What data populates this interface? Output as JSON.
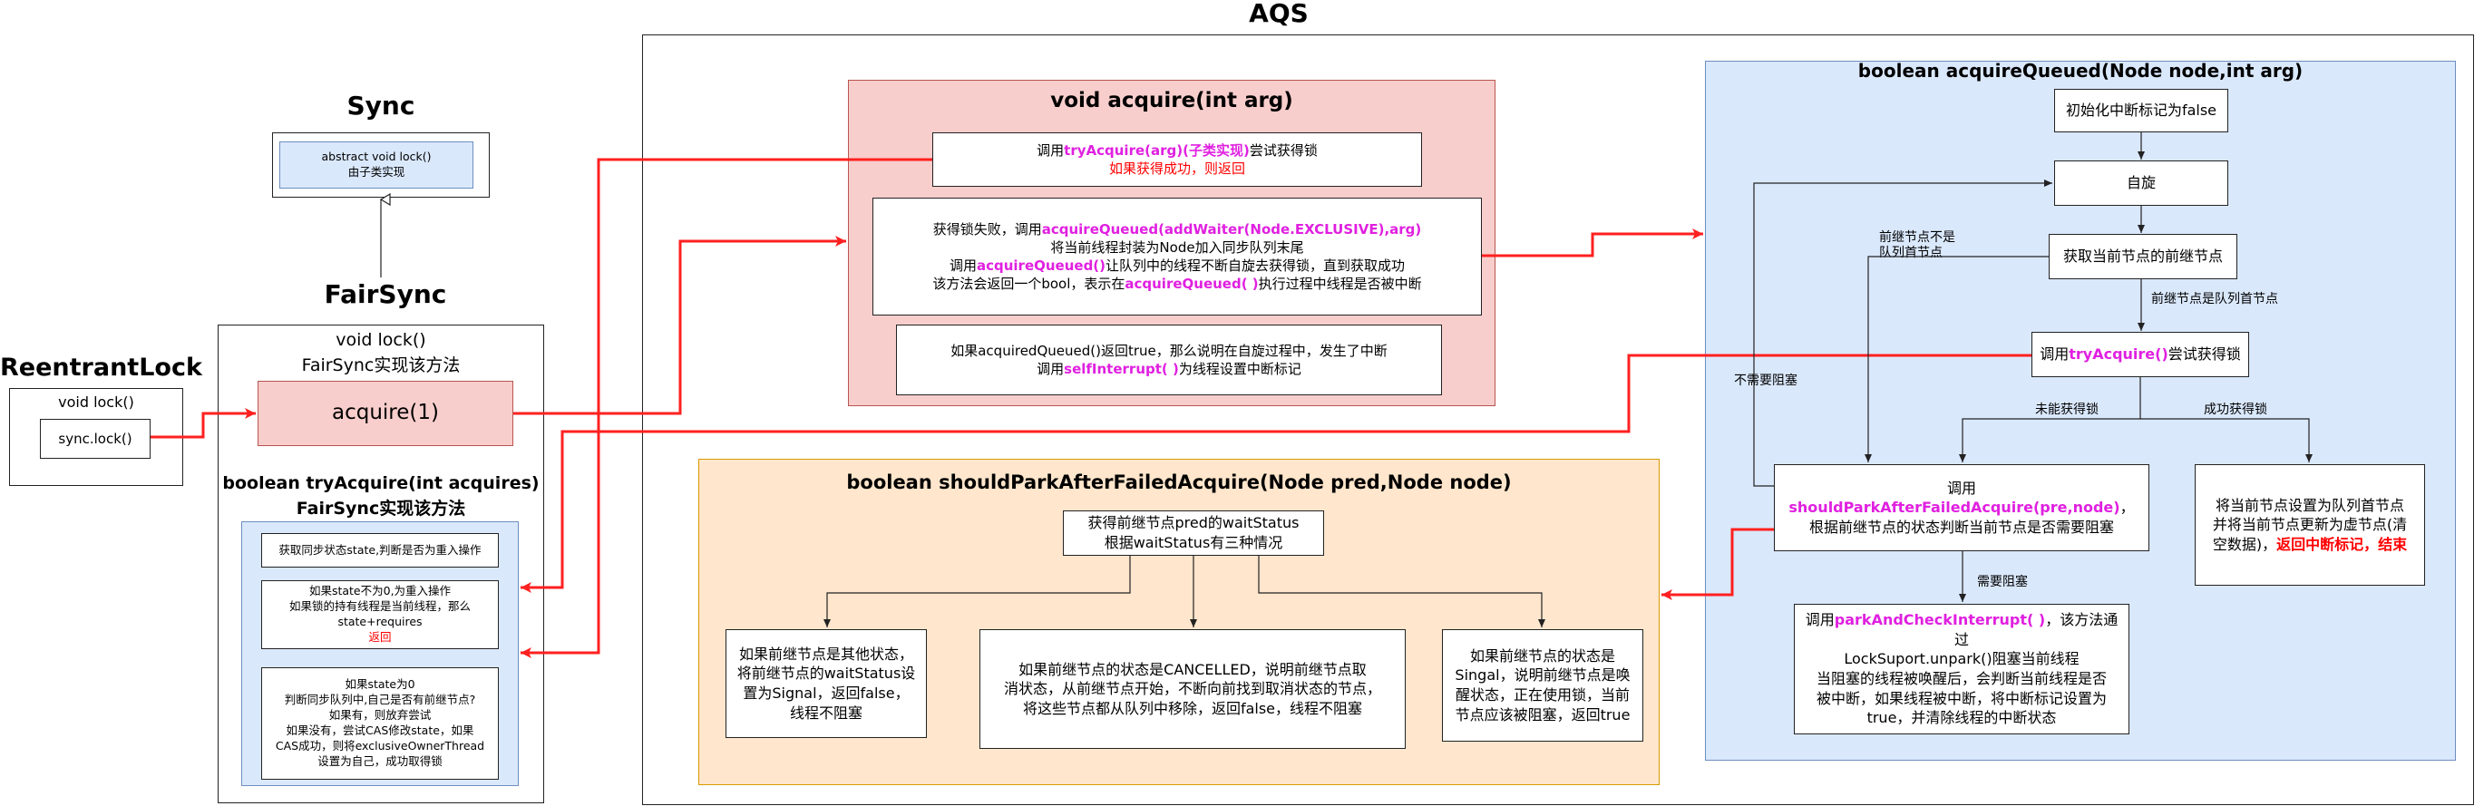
{
  "reentrant": {
    "title": "ReentrantLock",
    "lock_label": "void lock()",
    "call_label": "sync.lock()"
  },
  "sync": {
    "title": "Sync",
    "abstract_line1": "abstract void lock()",
    "abstract_line2": "由子类实现"
  },
  "fairsync": {
    "title": "FairSync",
    "lock_line1": "void lock()",
    "lock_line2": "FairSync实现该方法",
    "acquire_label": "acquire(1)",
    "try_title1": "boolean tryAcquire(int acquires)",
    "try_title2": "FairSync实现该方法",
    "step1": "获取同步状态state,判断是否为重入操作",
    "step2_l1": "如果state不为0,为重入操作",
    "step2_l2": "如果锁的持有线程是当前线程，那么",
    "step2_l3": "state+requires",
    "step2_l4": "返回",
    "step3_l1": "如果state为0",
    "step3_l2": "判断同步队列中,自己是否有前继节点?",
    "step3_l3": "如果有，则放弃尝试",
    "step3_l4": "如果没有，尝试CAS修改state，如果",
    "step3_l5": "CAS成功，则将exclusiveOwnerThread",
    "step3_l6": "设置为自己，成功取得锁"
  },
  "aqs": {
    "title": "AQS",
    "acquire": {
      "title": "void acquire(int arg)",
      "b1_pre": "调用",
      "b1_hl": "tryAcquire(arg)(子类实现)",
      "b1_post": "尝试获得锁",
      "b1_red": "如果获得成功，则返回",
      "b2_l1_pre": "获得锁失败，调用",
      "b2_l1_hl": "acquireQueued(addWaiter(Node.EXCLUSIVE),arg)",
      "b2_l2": "将当前线程封装为Node加入同步队列末尾",
      "b2_l3_pre": "调用",
      "b2_l3_hl": "acquireQueued()",
      "b2_l3_post": "让队列中的线程不断自旋去获得锁，直到获取成功",
      "b2_l4_pre": "该方法会返回一个bool，表示在",
      "b2_l4_hl": "acquireQueued( )",
      "b2_l4_post": "执行过程中线程是否被中断",
      "b3_l1": "如果acquiredQueued()返回true，那么说明在自旋过程中，发生了中断",
      "b3_l2_pre": "调用",
      "b3_l2_hl": "selfInterrupt( )",
      "b3_l2_post": "为线程设置中断标记"
    },
    "queued": {
      "title": "boolean acquireQueued(Node node,int arg)",
      "init": "初始化中断标记为false",
      "spin": "自旋",
      "get_pred": "获取当前节点的前继节点",
      "label_pred_not_head_1": "前继节点不是",
      "label_pred_not_head_2": "队列首节点",
      "label_pred_is_head": "前继节点是队列首节点",
      "try_pre": "调用",
      "try_hl": "tryAcquire()",
      "try_post": "尝试获得锁",
      "label_no_block": "不需要阻塞",
      "label_fail": "未能获得锁",
      "label_success": "成功获得锁",
      "should_pre": "调用",
      "should_hl": "shouldParkAfterFailedAcquire(pre,node)",
      "should_post": "，",
      "should_l2": "根据前继节点的状态判断当前节点是否需要阻塞",
      "success_l1": "将当前节点设置为队列首节点",
      "success_l2": "并将当前节点更新为虚节点(清",
      "success_l3_pre": "空数据)，",
      "success_l3_red": "返回中断标记，结束",
      "label_need_block": "需要阻塞",
      "park_pre": "调用",
      "park_hl": "parkAndCheckInterrupt( )",
      "park_post": "，该方法通过",
      "park_l2": "LockSuport.unpark()阻塞当前线程",
      "park_l3": "当阻塞的线程被唤醒后，会判断当前线程是否",
      "park_l4": "被中断，如果线程被中断，将中断标记设置为",
      "park_l5": "true，并清除线程的中断状态"
    },
    "should": {
      "title": "boolean shouldParkAfterFailedAcquire(Node pred,Node node)",
      "head_l1": "获得前继节点pred的waitStatus",
      "head_l2": "根据waitStatus有三种情况",
      "c1_l1": "如果前继节点是其他状态，",
      "c1_l2": "将前继节点的waitStatus设",
      "c1_l3": "置为Signal，返回false，",
      "c1_l4": "线程不阻塞",
      "c2_l1": "如果前继节点的状态是CANCELLED，说明前继节点取",
      "c2_l2": "消状态，从前继节点开始，不断向前找到取消状态的节点，",
      "c2_l3": "将这些节点都从队列中移除，返回false，线程不阻塞",
      "c3_l1": "如果前继节点的状态是",
      "c3_l2": "Singal，说明前继节点是唤",
      "c3_l3": "醒状态，正在使用锁，当前",
      "c3_l4": "节点应该被阻塞，返回true"
    }
  },
  "colors": {
    "red_arrow": "#ff2020",
    "pink_fill": "#f8cecc",
    "pink_border": "#b85450",
    "blue_fill": "#dae8fc",
    "blue_border": "#6c8ebf",
    "orange_fill": "#ffe6cc",
    "orange_border": "#d79b00",
    "highlight": "#e020e0"
  }
}
